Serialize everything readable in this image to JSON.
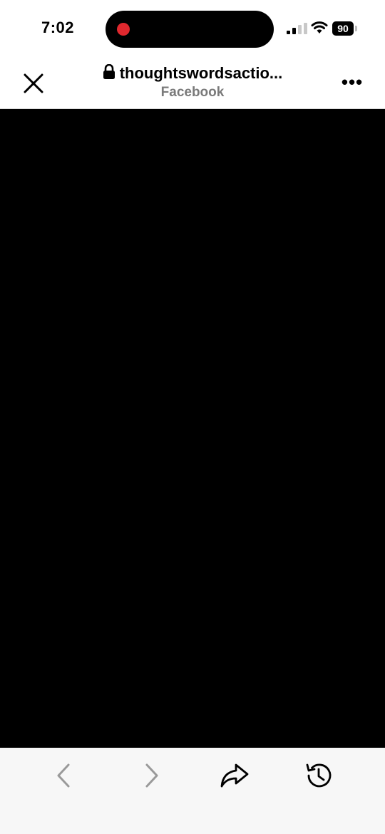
{
  "status_bar": {
    "time": "7:02",
    "battery_level": "90",
    "recording_indicator_color": "#e0282e"
  },
  "browser": {
    "url": "thoughtswordsactio...",
    "source_app": "Facebook",
    "more_label": "•••"
  },
  "toolbar": {
    "icons": [
      "chevron-left-icon",
      "chevron-right-icon",
      "share-icon",
      "history-icon"
    ]
  },
  "colors": {
    "content_background": "#000000",
    "toolbar_background": "#f7f7f7",
    "disabled_icon": "#9a9a9a"
  }
}
